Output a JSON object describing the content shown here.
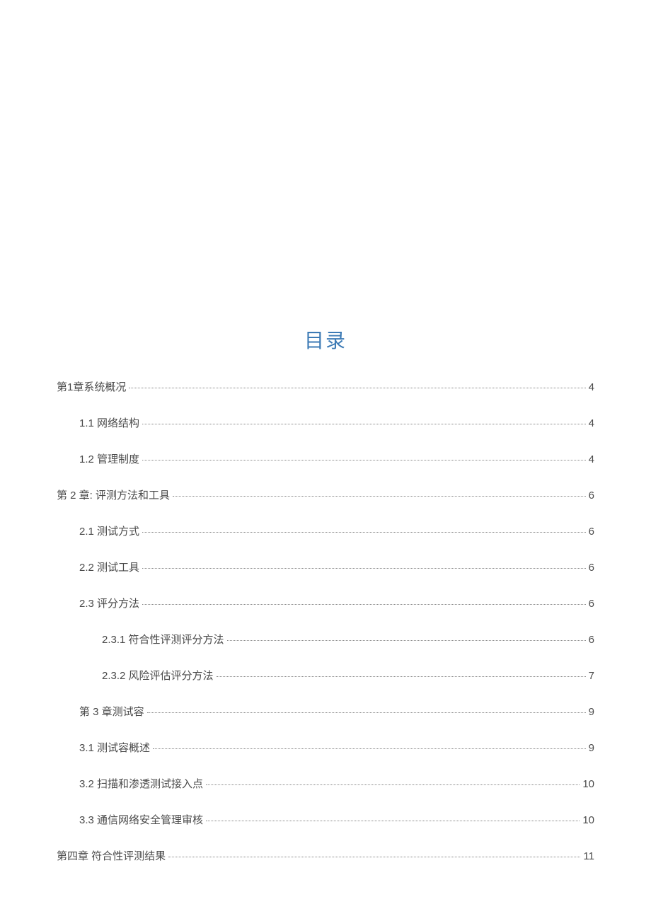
{
  "title": "目录",
  "toc": [
    {
      "label": "第1章系统概况",
      "page": "4",
      "level": 0
    },
    {
      "label": "1.1 网络结构",
      "page": "4",
      "level": 1
    },
    {
      "label": "1.2 管理制度",
      "page": "4",
      "level": 1
    },
    {
      "label": "第 2 章:  评测方法和工具",
      "page": "6",
      "level": 0
    },
    {
      "label": "2.1 测试方式",
      "page": "6",
      "level": 1
    },
    {
      "label": "2.2 测试工具",
      "page": "6",
      "level": 1
    },
    {
      "label": "2.3 评分方法",
      "page": "6",
      "level": 1
    },
    {
      "label": "2.3.1 符合性评测评分方法",
      "page": "6",
      "level": 2
    },
    {
      "label": "2.3.2 风险评估评分方法",
      "page": "7",
      "level": 2
    },
    {
      "label": "第 3 章测试容",
      "page": "9",
      "level": 1
    },
    {
      "label": "3.1 测试容概述",
      "page": "9",
      "level": 1
    },
    {
      "label": "3.2 扫描和渗透测试接入点",
      "page": "10",
      "level": 1
    },
    {
      "label": "3.3  通信网络安全管理审核",
      "page": "10",
      "level": 1
    },
    {
      "label": "第四章  符合性评测结果",
      "page": "11",
      "level": 0
    }
  ]
}
